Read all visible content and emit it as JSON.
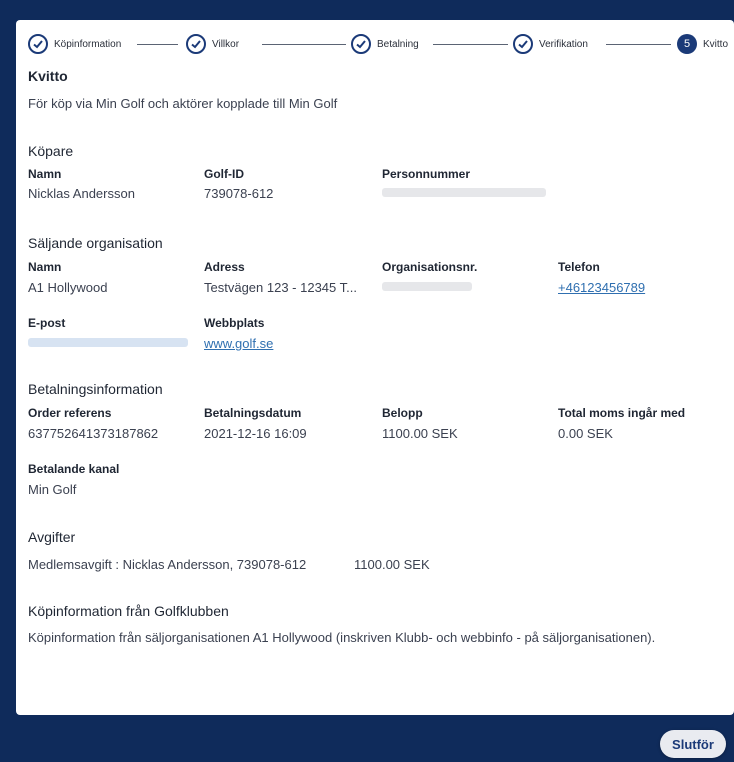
{
  "stepper": {
    "steps": [
      {
        "label": "Köpinformation",
        "state": "done"
      },
      {
        "label": "Villkor",
        "state": "done"
      },
      {
        "label": "Betalning",
        "state": "done"
      },
      {
        "label": "Verifikation",
        "state": "done"
      },
      {
        "label": "Kvitto",
        "state": "active",
        "number": "5"
      }
    ]
  },
  "receipt": {
    "title": "Kvitto",
    "subtitle": "För köp via Min Golf och aktörer kopplade till Min Golf"
  },
  "buyer": {
    "heading": "Köpare",
    "name_label": "Namn",
    "name": "Nicklas Andersson",
    "golfid_label": "Golf-ID",
    "golfid": "739078-612",
    "pnr_label": "Personnummer"
  },
  "seller": {
    "heading": "Säljande organisation",
    "name_label": "Namn",
    "name": "A1 Hollywood",
    "address_label": "Adress",
    "address": "Testvägen 123 - 12345 T...",
    "orgnr_label": "Organisationsnr.",
    "phone_label": "Telefon",
    "phone": "+46123456789",
    "email_label": "E-post",
    "web_label": "Webbplats",
    "web": "www.golf.se"
  },
  "payment": {
    "heading": "Betalningsinformation",
    "order_label": "Order referens",
    "order": "637752641373187862",
    "date_label": "Betalningsdatum",
    "date": "2021-12-16 16:09",
    "amount_label": "Belopp",
    "amount": "1100.00 SEK",
    "vat_label": "Total moms ingår med",
    "vat": "0.00 SEK",
    "channel_label": "Betalande kanal",
    "channel": "Min Golf"
  },
  "fees": {
    "heading": "Avgifter",
    "item": "Medlemsavgift : Nicklas Andersson, 739078-612",
    "item_amount": "1100.00 SEK"
  },
  "club_info": {
    "heading": "Köpinformation från Golfklubben",
    "text": "Köpinformation från säljorganisationen A1 Hollywood (inskriven Klubb- och webbinfo - på säljorganisationen)."
  },
  "footer": {
    "close_label": "Slutför"
  }
}
